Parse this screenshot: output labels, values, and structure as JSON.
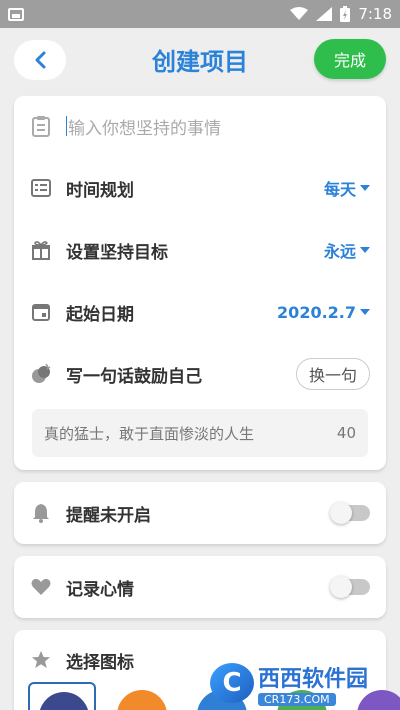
{
  "status_bar": {
    "time": "7:18"
  },
  "header": {
    "title": "创建项目",
    "done_label": "完成"
  },
  "form": {
    "name_placeholder": "输入你想坚持的事情",
    "schedule": {
      "label": "时间规划",
      "value": "每天"
    },
    "goal": {
      "label": "设置坚持目标",
      "value": "永远"
    },
    "start_date": {
      "label": "起始日期",
      "value": "2020.2.7"
    },
    "motto": {
      "label": "写一句话鼓励自己",
      "swap_label": "换一句",
      "text": "真的猛士，敢于直面惨淡的人生",
      "count": "40"
    }
  },
  "reminder": {
    "label": "提醒未开启",
    "enabled": false
  },
  "mood": {
    "label": "记录心情",
    "enabled": false
  },
  "icon_picker": {
    "label": "选择图标",
    "options": [
      {
        "color": "#3b4a8f",
        "selected": true
      },
      {
        "color": "#f08a2a",
        "selected": false
      },
      {
        "color": "#2f7fd6",
        "selected": false
      },
      {
        "color": "#4caf50",
        "selected": false
      },
      {
        "color": "#7d57c2",
        "selected": false
      }
    ]
  },
  "watermark": {
    "brand": "西西软件园",
    "site": "CR173.COM",
    "logo_letter": "C"
  },
  "colors": {
    "accent": "#2b82d9",
    "done": "#2fbd4b",
    "status_bar": "#9e9e9e"
  }
}
